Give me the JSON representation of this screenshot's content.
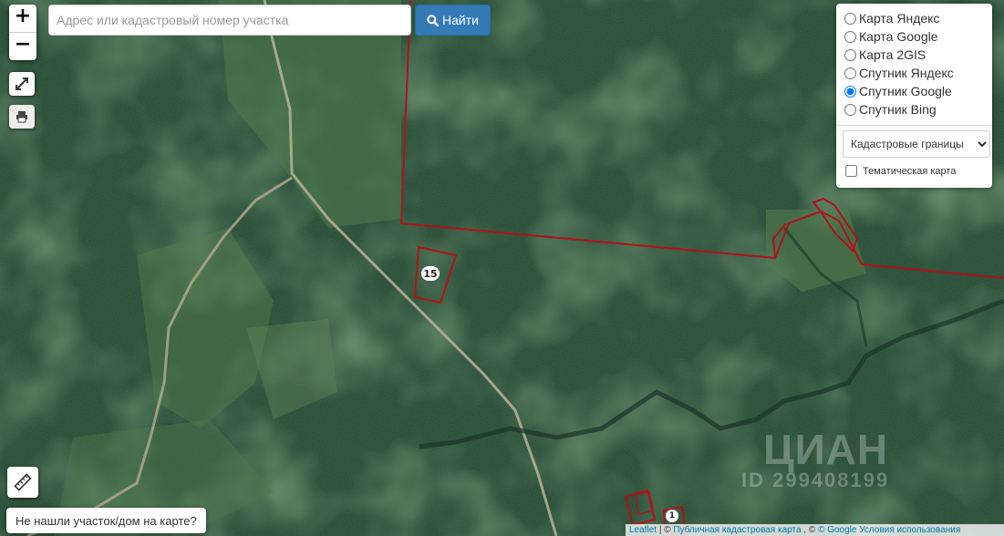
{
  "search": {
    "placeholder": "Адрес или кадастровый номер участка",
    "button_label": "Найти",
    "button_icon": "search-icon"
  },
  "zoom": {
    "in_label": "+",
    "out_label": "−"
  },
  "tools": {
    "fullscreen_icon": "expand-icon",
    "print_icon": "printer-icon",
    "ruler_icon": "ruler-icon"
  },
  "layers": {
    "base": [
      {
        "label": "Карта Яндекс",
        "selected": false
      },
      {
        "label": "Карта Google",
        "selected": false
      },
      {
        "label": "Карта 2GIS",
        "selected": false
      },
      {
        "label": "Спутник Яндекс",
        "selected": false
      },
      {
        "label": "Спутник Google",
        "selected": true
      },
      {
        "label": "Спутник Bing",
        "selected": false
      }
    ],
    "overlay_selected": "Кадастровые границы",
    "thematic_label": "Тематическая карта",
    "thematic_checked": false
  },
  "map": {
    "parcel_label": "15",
    "parcel_label_2": "1",
    "boundary_color": "#b0121b"
  },
  "not_found_button": "Не нашли участок/дом на карте?",
  "attribution": {
    "leaflet": "Leaflet",
    "cadastre": "Публичная кадастровая карта",
    "google": "© Google",
    "terms": "Условия использования"
  },
  "watermark": {
    "brand": "ЦИАН",
    "id": "ID 299408199"
  }
}
